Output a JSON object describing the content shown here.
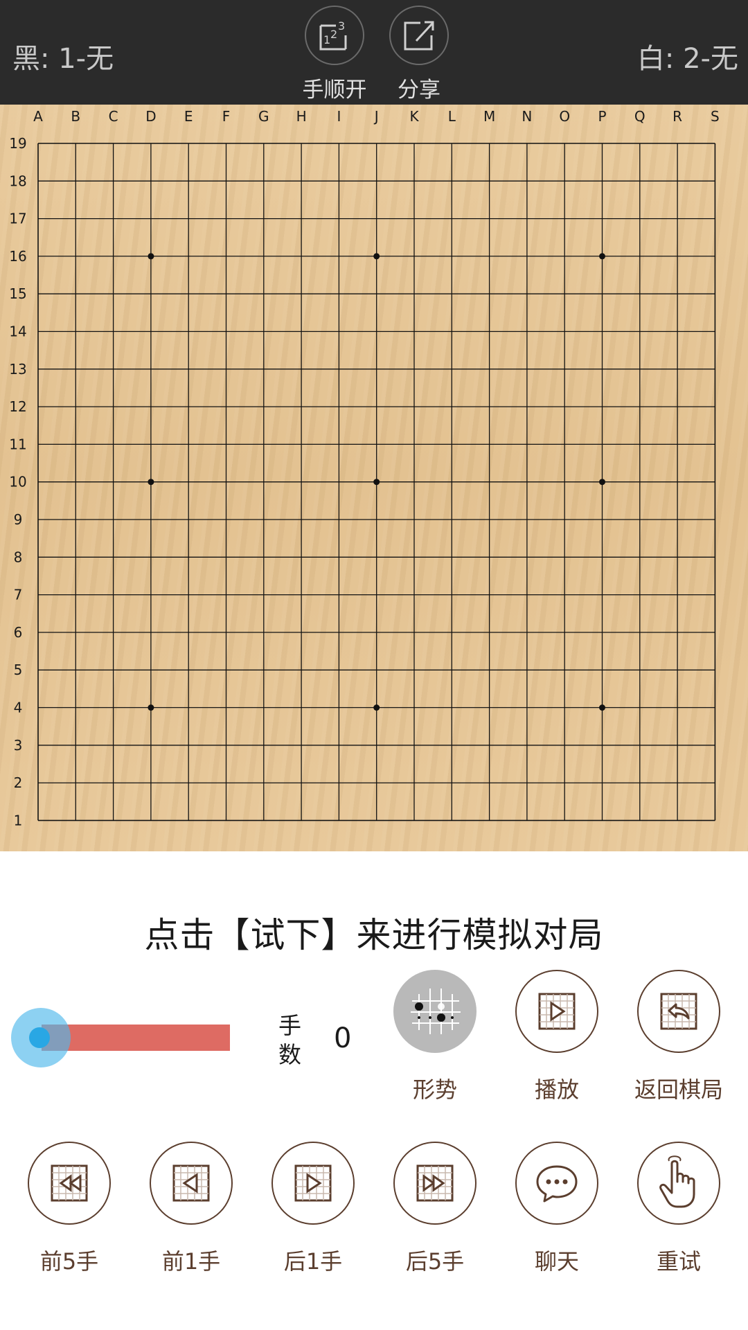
{
  "header": {
    "black_score": "黑: 1-无",
    "white_score": "白: 2-无",
    "move_order_label": "手顺开",
    "share_label": "分享",
    "move_order_icon": "move-order-icon",
    "share_icon": "share-icon"
  },
  "board": {
    "size": 19,
    "columns": [
      "A",
      "B",
      "C",
      "D",
      "E",
      "F",
      "G",
      "H",
      "I",
      "J",
      "K",
      "L",
      "M",
      "N",
      "O",
      "P",
      "Q",
      "R",
      "S"
    ],
    "rows": [
      "19",
      "18",
      "17",
      "16",
      "15",
      "14",
      "13",
      "12",
      "11",
      "10",
      "9",
      "8",
      "7",
      "6",
      "5",
      "4",
      "3",
      "2",
      "1"
    ],
    "star_points": [
      "D16",
      "J16",
      "P16",
      "D10",
      "J10",
      "P10",
      "D4",
      "J4",
      "P4"
    ],
    "stones": []
  },
  "hint": "点击【试下】来进行模拟对局",
  "progress": {
    "move_label": "手数",
    "move_count": "0",
    "track_color": "#de6b63",
    "thumb_color": "#29a7e4",
    "position_fraction": 0
  },
  "actions_row1": [
    {
      "label": "形势",
      "icon": "situation-icon"
    },
    {
      "label": "播放",
      "icon": "play-icon"
    },
    {
      "label": "返回棋局",
      "icon": "return-icon"
    }
  ],
  "actions_row2": [
    {
      "label": "前5手",
      "icon": "back-5-icon"
    },
    {
      "label": "前1手",
      "icon": "back-1-icon"
    },
    {
      "label": "后1手",
      "icon": "forward-1-icon"
    },
    {
      "label": "后5手",
      "icon": "forward-5-icon"
    },
    {
      "label": "聊天",
      "icon": "chat-icon"
    },
    {
      "label": "重试",
      "icon": "retry-icon"
    }
  ],
  "colors": {
    "topbar": "#2b2b2b",
    "board": "#e4c594",
    "icon_brown": "#5b3e2e"
  }
}
